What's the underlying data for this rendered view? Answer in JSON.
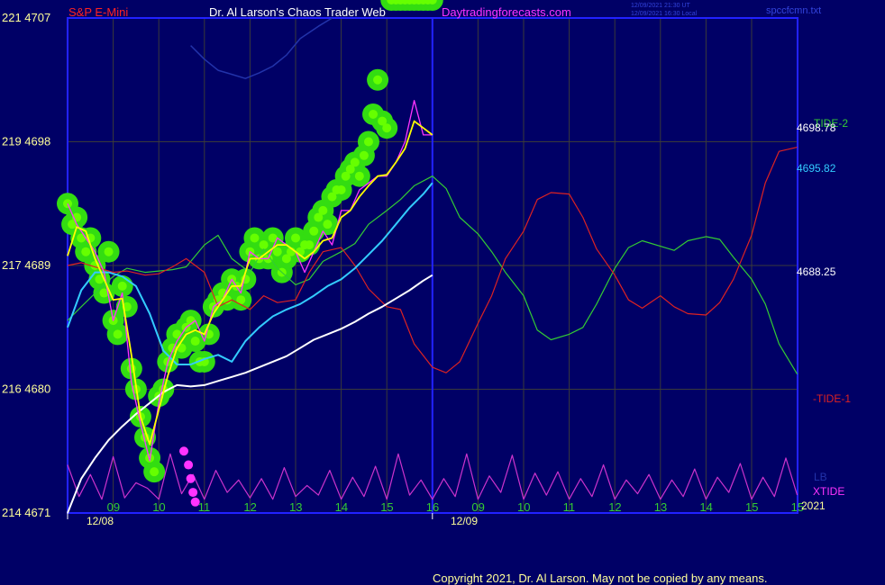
{
  "header": {
    "symbol": "S&P E-Mini",
    "title": "Dr. Al Larson's Chaos Trader Web",
    "site": "Daytradingforecasts.com",
    "stamp_line1": "12/09/2021 21:30 UT",
    "stamp_line2": "12/09/2021 16:30 Local",
    "file": "spccfcmn.txt"
  },
  "footer": {
    "copyright": "Copyright 2021, Dr. Al Larson. May not be copied by any means."
  },
  "colors": {
    "background": "#000066",
    "axis": "#2222ff",
    "grid": "#3a3a3a",
    "price": "#ff33ff",
    "ma_fast": "#ffff00",
    "ma_mid": "#33ccff",
    "ma_slow": "#ffffff",
    "tide2": "#33cc33",
    "tide1": "#dd2222",
    "xtide": "#cc33cc",
    "lb": "#2233aa",
    "bubbles": "#33dd11",
    "bubble_core": "#66ff00",
    "markers": "#ff33ff",
    "tick_labels": "#ffff99",
    "hour_labels": "#33cc33"
  },
  "chart_data": {
    "type": "line",
    "price_axis": {
      "labels": [
        {
          "emini": "221",
          "price": "4707"
        },
        {
          "emini": "219",
          "price": "4698"
        },
        {
          "emini": "217",
          "price": "4689"
        },
        {
          "emini": "216",
          "price": "4680"
        },
        {
          "emini": "214",
          "price": "4671"
        }
      ],
      "ylim": [
        4671,
        4707
      ]
    },
    "hour_ticks_day1": [
      "09",
      "10",
      "11",
      "12",
      "13",
      "14",
      "15",
      "16"
    ],
    "hour_ticks_day2": [
      "09",
      "10",
      "11",
      "12",
      "13",
      "14",
      "15",
      "15"
    ],
    "date_labels": [
      "12/08",
      "12/09"
    ],
    "year_label": "2021",
    "right_labels": {
      "tide2": "TIDE-2",
      "tide1": "-TIDE-1",
      "lb": "LB",
      "xtide": "XTIDE",
      "level1": "4698.78",
      "level2": "4695.82",
      "level3": "4688.25"
    },
    "series": [
      {
        "name": "TIDE-2",
        "x": [
          0,
          0.3,
          0.7,
          1.0,
          1.3,
          1.7,
          2.0,
          2.3,
          2.6,
          3.0,
          3.3,
          3.6,
          4.0,
          4.3,
          4.6,
          5.0,
          5.3,
          5.6,
          6.0,
          6.3,
          6.6,
          7.0,
          7.3,
          7.6,
          8.0,
          8.3,
          8.6,
          9.0,
          9.3,
          9.6,
          10.0,
          10.3,
          10.6,
          11.0,
          11.3,
          11.6,
          12.0,
          12.3,
          12.6,
          13.0,
          13.3,
          13.6,
          14.0,
          14.3,
          14.6,
          15.0,
          15.3,
          15.6,
          16.0
        ],
        "values": [
          4685.0,
          4686.0,
          4687.3,
          4688.2,
          4688.8,
          4688.5,
          4688.6,
          4688.7,
          4688.9,
          4690.5,
          4691.2,
          4689.5,
          4688.5,
          4690.2,
          4688.8,
          4687.6,
          4688.0,
          4689.3,
          4690.0,
          4690.6,
          4692.0,
          4693.0,
          4693.8,
          4694.8,
          4695.5,
          4694.6,
          4692.5,
          4691.3,
          4690.0,
          4688.5,
          4686.8,
          4684.3,
          4683.6,
          4684.0,
          4684.5,
          4686.2,
          4688.8,
          4690.3,
          4690.8,
          4690.4,
          4690.1,
          4690.8,
          4691.1,
          4690.9,
          4689.6,
          4688.0,
          4686.2,
          4683.3,
          4681.1
        ]
      },
      {
        "name": "TIDE-1",
        "x": [
          0,
          0.3,
          0.7,
          1.0,
          1.3,
          1.7,
          2.0,
          2.3,
          2.6,
          3.0,
          3.3,
          3.6,
          4.0,
          4.3,
          4.6,
          5.0,
          5.3,
          5.6,
          6.0,
          6.3,
          6.6,
          7.0,
          7.3,
          7.6,
          8.0,
          8.3,
          8.6,
          9.0,
          9.3,
          9.6,
          10.0,
          10.3,
          10.6,
          11.0,
          11.3,
          11.6,
          12.0,
          12.3,
          12.6,
          13.0,
          13.3,
          13.6,
          14.0,
          14.3,
          14.6,
          15.0,
          15.3,
          15.6,
          16.0
        ],
        "values": [
          4689.0,
          4689.2,
          4688.8,
          4688.5,
          4688.6,
          4688.3,
          4688.4,
          4688.9,
          4689.5,
          4688.5,
          4686.0,
          4686.5,
          4685.8,
          4686.8,
          4686.3,
          4686.5,
          4688.5,
          4690.0,
          4690.3,
          4689.0,
          4687.3,
          4686.0,
          4685.8,
          4683.3,
          4681.6,
          4681.2,
          4682.0,
          4684.8,
          4686.8,
          4689.5,
          4691.5,
          4693.8,
          4694.3,
          4694.2,
          4692.5,
          4690.2,
          4688.3,
          4686.5,
          4685.9,
          4686.8,
          4686.0,
          4685.5,
          4685.4,
          4686.3,
          4688.0,
          4691.2,
          4695.0,
          4697.3,
          4697.6
        ]
      },
      {
        "name": "XTIDE",
        "x": [
          0,
          0.25,
          0.5,
          0.75,
          1.0,
          1.25,
          1.5,
          1.75,
          2.0,
          2.25,
          2.5,
          2.75,
          3.0,
          3.25,
          3.5,
          3.75,
          4.0,
          4.25,
          4.5,
          4.75,
          5.0,
          5.25,
          5.5,
          5.75,
          6.0,
          6.25,
          6.5,
          6.75,
          7.0,
          7.25,
          7.5,
          7.75,
          8.0,
          8.25,
          8.5,
          8.75,
          9.0,
          9.25,
          9.5,
          9.75,
          10.0,
          10.25,
          10.5,
          10.75,
          11.0,
          11.25,
          11.5,
          11.75,
          12.0,
          12.25,
          12.5,
          12.75,
          13.0,
          13.25,
          13.5,
          13.75,
          14.0,
          14.25,
          14.5,
          14.75,
          15.0,
          15.25,
          15.5,
          15.75,
          16.0
        ],
        "values": [
          4674.5,
          4672.2,
          4673.8,
          4672.0,
          4675.1,
          4672.1,
          4673.2,
          4672.8,
          4672.0,
          4675.3,
          4672.4,
          4673.8,
          4672.0,
          4674.1,
          4672.5,
          4673.4,
          4672.1,
          4673.5,
          4672.0,
          4674.3,
          4672.2,
          4673.0,
          4672.3,
          4674.1,
          4672.0,
          4673.6,
          4672.2,
          4674.4,
          4672.0,
          4675.3,
          4672.3,
          4673.4,
          4672.0,
          4673.5,
          4672.2,
          4675.3,
          4672.0,
          4673.7,
          4672.5,
          4675.2,
          4672.0,
          4673.9,
          4672.3,
          4674.0,
          4672.0,
          4673.5,
          4672.2,
          4674.5,
          4672.0,
          4673.4,
          4672.4,
          4673.8,
          4672.0,
          4673.4,
          4672.2,
          4674.2,
          4672.0,
          4673.6,
          4672.5,
          4674.6,
          4672.0,
          4673.6,
          4672.2,
          4675.0,
          4672.3
        ]
      },
      {
        "name": "LB",
        "x": [
          2.7,
          3.0,
          3.3,
          3.6,
          3.9,
          4.2,
          4.5,
          4.8,
          5.1,
          5.5,
          5.8
        ],
        "values": [
          4705.0,
          4704.0,
          4703.2,
          4702.9,
          4702.6,
          4703.0,
          4703.5,
          4704.3,
          4705.5,
          4706.4,
          4707.0
        ]
      },
      {
        "name": "price",
        "x": [
          0,
          0.2,
          0.4,
          0.6,
          0.8,
          1.0,
          1.2,
          1.4,
          1.6,
          1.8,
          2.0,
          2.2,
          2.4,
          2.6,
          2.8,
          3.0,
          3.2,
          3.4,
          3.6,
          3.8,
          4.0,
          4.2,
          4.4,
          4.6,
          4.8,
          5.0,
          5.2,
          5.4,
          5.6,
          5.8,
          6.0,
          6.2,
          6.4,
          6.6,
          6.8,
          7.0,
          7.2,
          7.4,
          7.6,
          7.8,
          8.0
        ],
        "values": [
          4693.5,
          4692.0,
          4691.0,
          4690.0,
          4688.5,
          4685.0,
          4687.0,
          4680.5,
          4677.5,
          4674.8,
          4679.0,
          4682.0,
          4683.5,
          4684.5,
          4685.0,
          4683.5,
          4686.0,
          4686.5,
          4688.0,
          4687.0,
          4690.0,
          4689.5,
          4689.5,
          4691.0,
          4690.5,
          4690.0,
          4688.5,
          4690.0,
          4691.5,
          4690.5,
          4693.0,
          4693.0,
          4694.5,
          4695.0,
          4695.5,
          4695.5,
          4696.5,
          4698.0,
          4701.0,
          4698.5,
          4698.5
        ]
      },
      {
        "name": "fast-avg",
        "x": [
          0,
          0.2,
          0.4,
          0.6,
          0.8,
          1.0,
          1.2,
          1.4,
          1.6,
          1.8,
          2.0,
          2.2,
          2.4,
          2.6,
          2.8,
          3.0,
          3.2,
          3.4,
          3.6,
          3.8,
          4.0,
          4.2,
          4.4,
          4.6,
          4.8,
          5.0,
          5.2,
          5.4,
          5.6,
          5.8,
          6.0,
          6.2,
          6.4,
          6.6,
          6.8,
          7.0,
          7.2,
          7.4,
          7.6,
          7.8,
          8.0
        ],
        "values": [
          4689.7,
          4691.8,
          4691.5,
          4689.5,
          4688.0,
          4686.5,
          4686.6,
          4682.5,
          4678.0,
          4676.0,
          4678.5,
          4681.0,
          4683.0,
          4684.0,
          4684.3,
          4684.0,
          4685.5,
          4686.5,
          4687.5,
          4687.5,
          4689.5,
          4689.5,
          4690.0,
          4690.5,
          4690.5,
          4690.0,
          4689.5,
          4690.0,
          4690.8,
          4691.0,
          4692.5,
          4693.0,
          4694.0,
          4694.8,
          4695.5,
          4695.6,
          4696.5,
          4697.5,
          4699.5,
          4699.0,
          4698.5
        ]
      },
      {
        "name": "mid-avg",
        "x": [
          0,
          0.3,
          0.6,
          0.9,
          1.2,
          1.5,
          1.8,
          2.1,
          2.4,
          2.7,
          3.0,
          3.3,
          3.6,
          3.9,
          4.2,
          4.5,
          4.8,
          5.1,
          5.4,
          5.7,
          6.0,
          6.3,
          6.6,
          6.9,
          7.2,
          7.5,
          7.8,
          8.0
        ],
        "values": [
          4684.5,
          4687.2,
          4688.5,
          4688.5,
          4688.2,
          4687.5,
          4685.5,
          4682.8,
          4681.8,
          4681.8,
          4682.2,
          4682.5,
          4682.0,
          4683.5,
          4684.5,
          4685.3,
          4685.8,
          4686.2,
          4686.8,
          4687.5,
          4688.0,
          4688.8,
          4689.8,
          4690.8,
          4692.0,
          4693.2,
          4694.2,
          4695.0
        ]
      },
      {
        "name": "slow-avg",
        "x": [
          0,
          0.3,
          0.6,
          0.9,
          1.2,
          1.5,
          1.8,
          2.1,
          2.4,
          2.7,
          3.0,
          3.3,
          3.6,
          3.9,
          4.2,
          4.5,
          4.8,
          5.1,
          5.4,
          5.7,
          6.0,
          6.3,
          6.6,
          6.9,
          7.2,
          7.5,
          7.8,
          8.0
        ],
        "values": [
          4671.0,
          4673.5,
          4675.0,
          4676.3,
          4677.3,
          4678.2,
          4679.0,
          4679.8,
          4680.3,
          4680.2,
          4680.3,
          4680.6,
          4680.9,
          4681.2,
          4681.6,
          4682.0,
          4682.4,
          4683.0,
          4683.6,
          4684.0,
          4684.4,
          4684.9,
          4685.5,
          4686.0,
          4686.6,
          4687.2,
          4687.9,
          4688.3
        ]
      }
    ],
    "bubbles": {
      "x": [
        0,
        0.1,
        0.2,
        0.3,
        0.4,
        0.5,
        0.6,
        0.7,
        0.8,
        0.9,
        1.0,
        1.1,
        1.2,
        1.3,
        1.4,
        1.5,
        1.6,
        1.7,
        1.8,
        1.9,
        2.0,
        2.1,
        2.2,
        2.3,
        2.4,
        2.5,
        2.6,
        2.7,
        2.8,
        2.9,
        3.0,
        3.1,
        3.2,
        3.3,
        3.4,
        3.5,
        3.6,
        3.7,
        3.8,
        3.9,
        4.0,
        4.1,
        4.2,
        4.3,
        4.4,
        4.5,
        4.6,
        4.7,
        4.8,
        4.9,
        5.0,
        5.1,
        5.2,
        5.3,
        5.4,
        5.5,
        5.6,
        5.7,
        5.8,
        5.9,
        6.0,
        6.1,
        6.2,
        6.3,
        6.4,
        6.5,
        6.6,
        6.7,
        6.8,
        6.9,
        7.0,
        7.1,
        7.2,
        7.3,
        7.4,
        7.5,
        7.6,
        7.7,
        7.8,
        7.9,
        8.0
      ],
      "values": [
        4693.5,
        4692.0,
        4692.5,
        4691.0,
        4690.0,
        4691.0,
        4689.0,
        4688.0,
        4687.0,
        4690.0,
        4685.0,
        4684.0,
        4687.5,
        4686.0,
        4681.5,
        4680.0,
        4678.0,
        4676.5,
        4675.0,
        4674.0,
        4679.5,
        4680.0,
        4682.0,
        4683.0,
        4684.0,
        4683.0,
        4684.5,
        4685.0,
        4683.5,
        4682.0,
        4682.0,
        4684.0,
        4686.0,
        4686.5,
        4687.0,
        4686.5,
        4688.0,
        4687.5,
        4686.5,
        4688.0,
        4690.0,
        4691.0,
        4689.5,
        4690.5,
        4689.5,
        4691.0,
        4690.0,
        4688.5,
        4689.5,
        4690.0,
        4691.0,
        4690.0,
        4690.5,
        4690.5,
        4691.5,
        4692.5,
        4693.0,
        4692.0,
        4694.0,
        4694.5,
        4694.5,
        4695.5,
        4696.0,
        4696.5,
        4695.5,
        4697.0,
        4698.0,
        4700.0,
        4702.5,
        4699.5,
        4699.0
      ]
    },
    "markers": {
      "x": [
        2.55,
        2.65,
        2.7,
        2.75,
        2.8
      ],
      "values": [
        4675.5,
        4674.5,
        4673.5,
        4672.5,
        4671.8
      ]
    }
  }
}
